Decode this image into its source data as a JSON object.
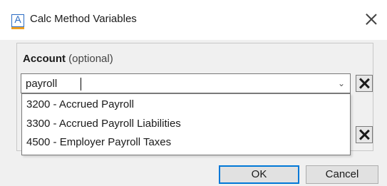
{
  "window": {
    "title": "Calc Method Variables",
    "app_icon_letter": "A",
    "close_icon": "close-icon"
  },
  "account": {
    "label": "Account",
    "optional_label": "(optional)",
    "input_value": "payroll",
    "dropdown_icon": "chevron-down-icon",
    "clear_icon": "clear-x-icon"
  },
  "dropdown": {
    "items": [
      "3200 - Accrued Payroll",
      "3300 - Accrued Payroll Liabilities",
      "4500 - Employer Payroll Taxes"
    ]
  },
  "buttons": {
    "ok_label": "OK",
    "cancel_label": "Cancel"
  },
  "colors": {
    "accent": "#0078d7",
    "icon_blue": "#2b6cc4",
    "icon_orange": "#f0a020",
    "panel_bg": "#f0f0f0"
  }
}
